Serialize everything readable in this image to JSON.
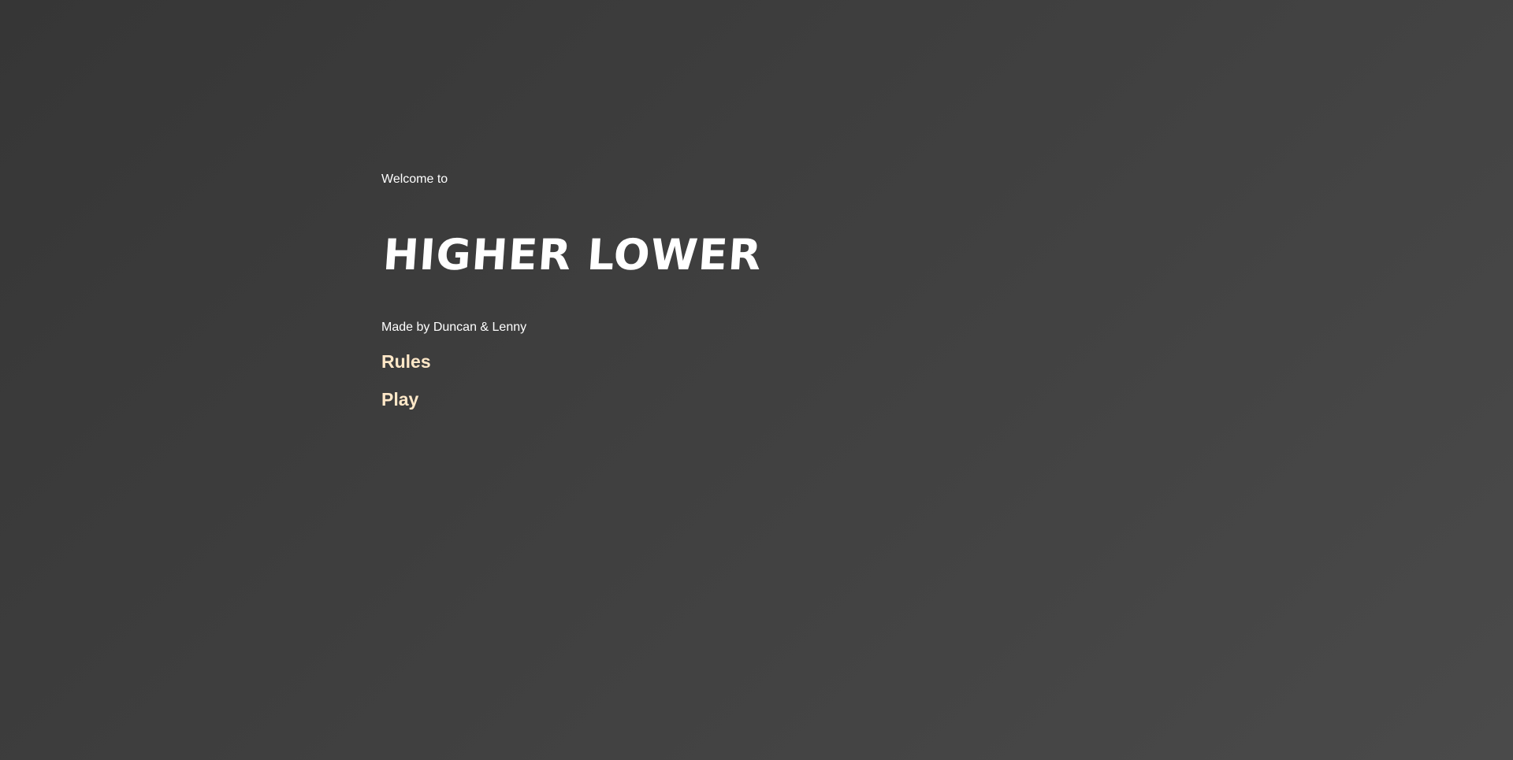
{
  "page": {
    "welcome": "Welcome to",
    "title": "HIGHER LOWER",
    "credits": "Made by Duncan & Lenny"
  },
  "nav": {
    "rules_label": "Rules",
    "play_label": "Play"
  },
  "colors": {
    "background_start": "#363636",
    "background_end": "#4a4a4a",
    "text": "#ffffff",
    "link": "#ffe8c8"
  }
}
